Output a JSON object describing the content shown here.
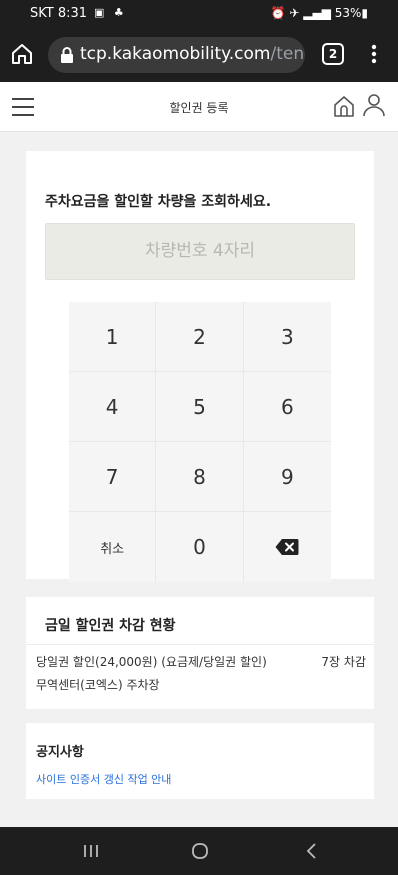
{
  "status_bar": {
    "carrier_time": "SKT 8:31",
    "battery": "53%"
  },
  "browser": {
    "url_host": "tcp.kakaomobility.com",
    "url_path": "/tenar",
    "tab_count": "2"
  },
  "header": {
    "title": "할인권 등록"
  },
  "search_card": {
    "heading": "주차요금을 할인할 차량을 조회하세요.",
    "plate_placeholder": "차량번호 4자리",
    "keys": [
      "1",
      "2",
      "3",
      "4",
      "5",
      "6",
      "7",
      "8",
      "9",
      "취소",
      "0"
    ]
  },
  "status_card": {
    "heading": "금일 할인권 차감 현황",
    "item_name": "당일권 할인(24,000원) (요금제/당일권 할인)",
    "item_count": "7장 차감",
    "location": "무역센터(코엑스) 주차장"
  },
  "notice_card": {
    "heading": "공지사항",
    "link": "사이트 인증서 갱신 작업 안내"
  },
  "colors": {
    "link": "#2a6fdb",
    "chrome_dark": "#1e1e1e"
  }
}
